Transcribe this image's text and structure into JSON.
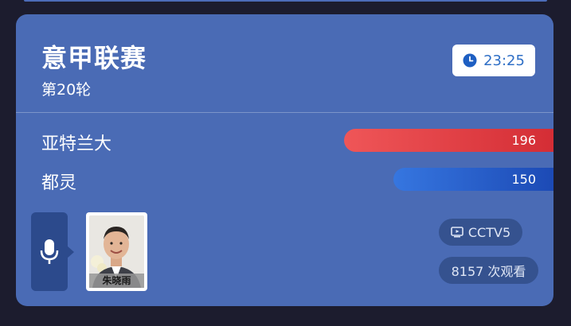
{
  "match": {
    "league": "意甲联赛",
    "round": "第20轮",
    "time": "23:25",
    "time_icon": "clock-icon"
  },
  "teams": [
    {
      "name": "亚特兰大",
      "votes": "196",
      "vote_value": 196,
      "color": "#e0383e"
    },
    {
      "name": "都灵",
      "votes": "150",
      "vote_value": 150,
      "color": "#2a63cf"
    }
  ],
  "commentary": {
    "mic_icon": "microphone-icon",
    "commentator_name": "朱晓雨"
  },
  "broadcast": {
    "channel": "CCTV5",
    "channel_icon": "tv-icon",
    "views": "8157 次观看"
  },
  "colors": {
    "card_bg": "#4a6bb5",
    "page_bg": "#1c1c2e",
    "time_text": "#2f6fc6"
  }
}
